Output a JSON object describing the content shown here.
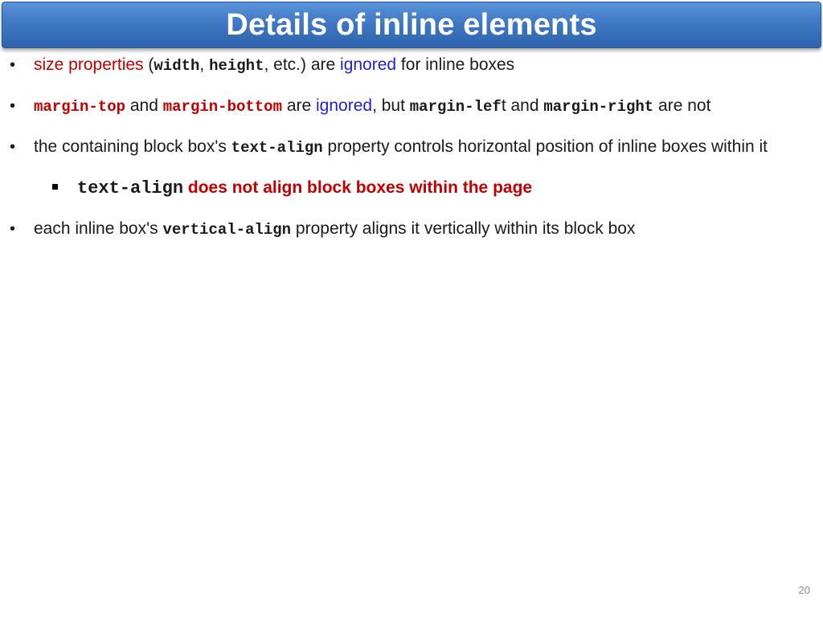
{
  "slide": {
    "title": "Details of inline elements",
    "page_number": "20"
  },
  "bullets": [
    {
      "parts": [
        "size properties",
        " (",
        "width",
        ", ",
        "height",
        ", etc.) are ",
        "ignored",
        " for inline boxes"
      ]
    },
    {
      "parts": [
        "margin-top",
        " and ",
        "margin-bottom",
        " are ",
        "ignored",
        ", but ",
        "margin-lef",
        "t and ",
        "margin-right",
        " are not"
      ]
    },
    {
      "parts": [
        "the containing block box's ",
        "text-align",
        " property controls horizontal position of inline boxes within it"
      ],
      "sub_bullets": [
        {
          "parts": [
            "text-align",
            " does not align block boxes within the page"
          ]
        }
      ]
    },
    {
      "parts": [
        "each inline box's ",
        "vertical-align",
        " property aligns it vertically within its block box"
      ]
    }
  ],
  "colors": {
    "title_bar": "#3f78c4",
    "title_text": "#ffffff",
    "emphasis_red": "#c00000",
    "emphasis_blue": "#1f1fd6"
  }
}
